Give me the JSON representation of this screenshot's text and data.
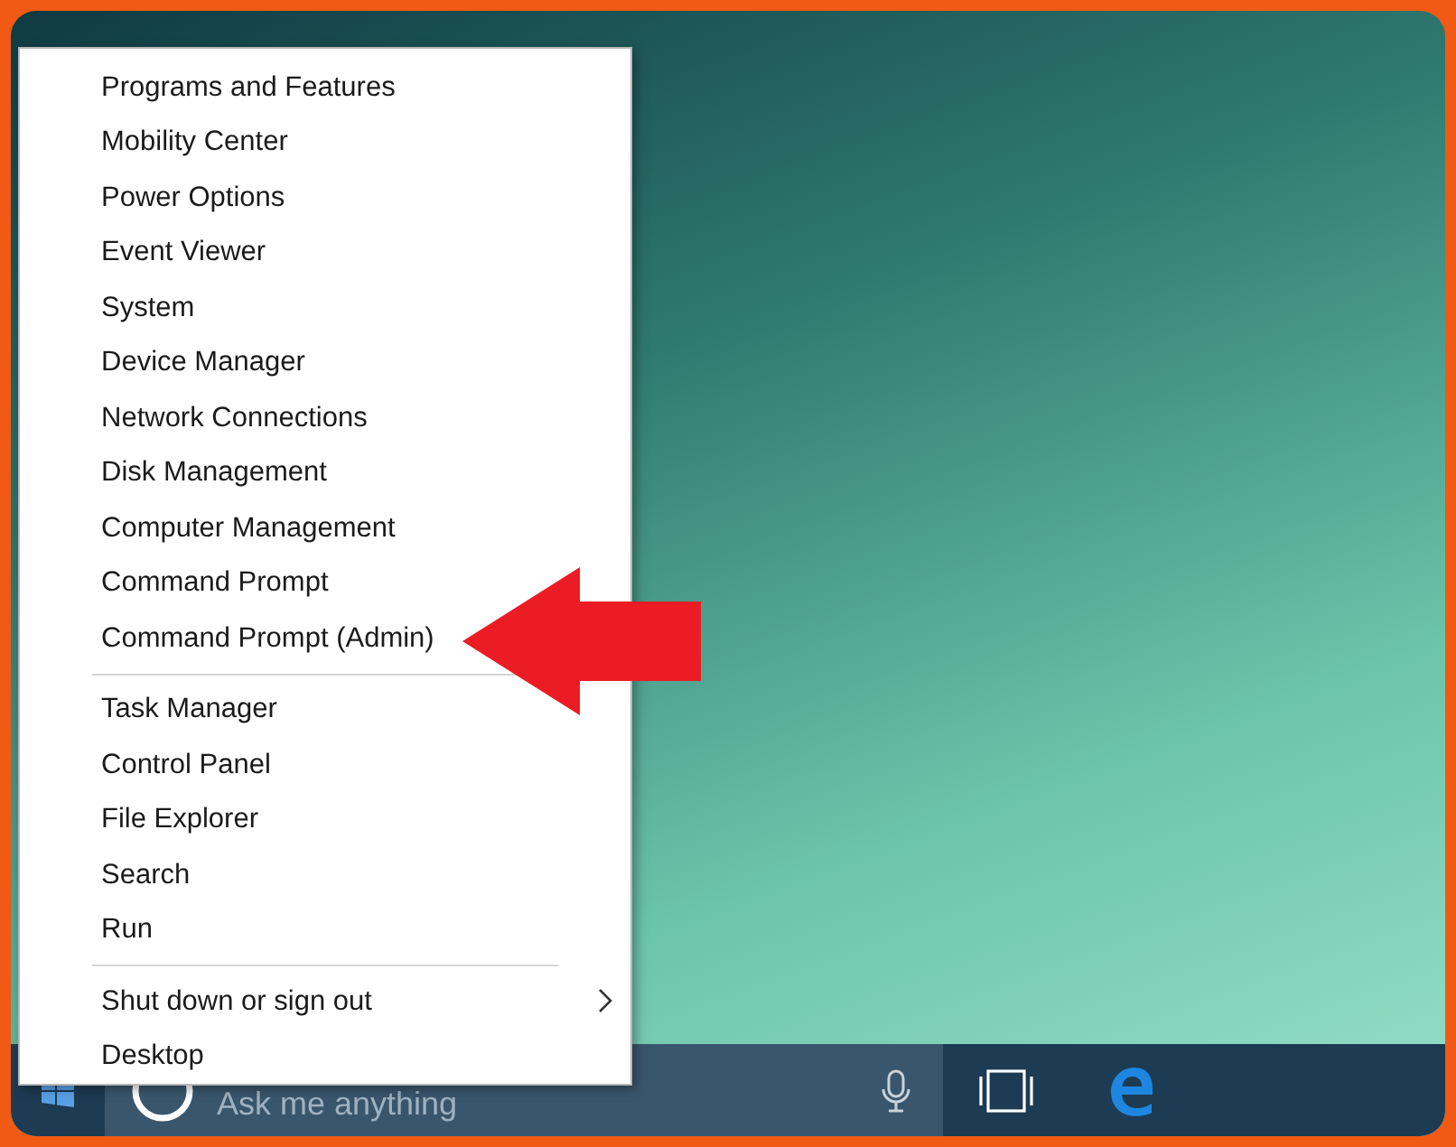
{
  "menu": {
    "groups": [
      {
        "items": [
          {
            "label": "Programs and Features",
            "has_submenu": false
          },
          {
            "label": "Mobility Center",
            "has_submenu": false
          },
          {
            "label": "Power Options",
            "has_submenu": false
          },
          {
            "label": "Event Viewer",
            "has_submenu": false
          },
          {
            "label": "System",
            "has_submenu": false
          },
          {
            "label": "Device Manager",
            "has_submenu": false
          },
          {
            "label": "Network Connections",
            "has_submenu": false
          },
          {
            "label": "Disk Management",
            "has_submenu": false
          },
          {
            "label": "Computer Management",
            "has_submenu": false
          },
          {
            "label": "Command Prompt",
            "has_submenu": false
          },
          {
            "label": "Command Prompt (Admin)",
            "has_submenu": false
          }
        ]
      },
      {
        "items": [
          {
            "label": "Task Manager",
            "has_submenu": false
          },
          {
            "label": "Control Panel",
            "has_submenu": false
          },
          {
            "label": "File Explorer",
            "has_submenu": false
          },
          {
            "label": "Search",
            "has_submenu": false
          },
          {
            "label": "Run",
            "has_submenu": false
          }
        ]
      },
      {
        "items": [
          {
            "label": "Shut down or sign out",
            "has_submenu": true
          },
          {
            "label": "Desktop",
            "has_submenu": false
          }
        ]
      }
    ]
  },
  "taskbar": {
    "search": {
      "placeholder": "Ask me anything"
    }
  }
}
